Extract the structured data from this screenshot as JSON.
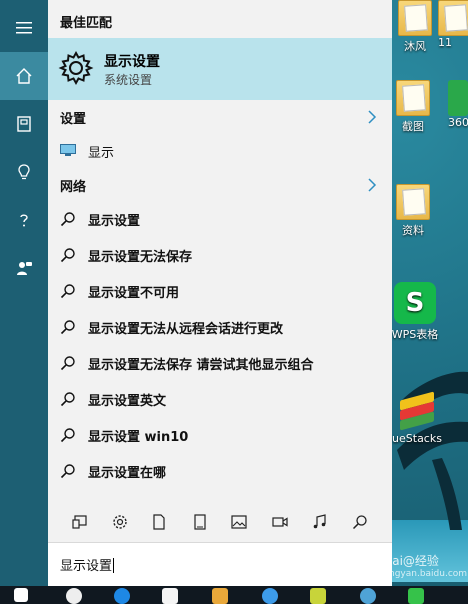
{
  "desktop": {
    "icons": [
      {
        "label": "沐风",
        "icon": "folder-icon"
      },
      {
        "label": "11",
        "icon": "folder-icon"
      },
      {
        "label": "截图",
        "icon": "folder-icon"
      },
      {
        "label": "360",
        "icon": "app-icon"
      },
      {
        "label": "资料",
        "icon": "folder-icon"
      },
      {
        "label": "WPS表格",
        "icon": "wps-spreadsheet-icon"
      },
      {
        "label": "ueStacks",
        "icon": "bluestacks-icon"
      }
    ]
  },
  "rail": {
    "items": [
      {
        "name": "menu",
        "icon": "hamburger-icon"
      },
      {
        "name": "home",
        "icon": "home-icon",
        "active": true
      },
      {
        "name": "notebook",
        "icon": "notebook-icon"
      },
      {
        "name": "tips",
        "icon": "lightbulb-icon"
      },
      {
        "name": "help",
        "icon": "question-icon"
      },
      {
        "name": "feedback",
        "icon": "feedback-icon"
      }
    ]
  },
  "panel": {
    "best_match_header": "最佳匹配",
    "best_match": {
      "title": "显示设置",
      "subtitle": "系统设置",
      "icon": "gear-icon"
    },
    "settings_header": "设置",
    "settings_item": {
      "label": "显示",
      "icon": "monitor-icon"
    },
    "web_header": "网络",
    "suggestions": [
      {
        "bold": "显示设置",
        "rest": ""
      },
      {
        "bold": "显示设置",
        "rest": "无法保存"
      },
      {
        "bold": "显示设置",
        "rest": "不可用"
      },
      {
        "bold": "显示设置",
        "rest": "无法从远程会话进行更改"
      },
      {
        "bold": "显示设置",
        "rest": "无法保存 请尝试其他显示组合"
      },
      {
        "bold": "显示设置",
        "rest": "英文"
      },
      {
        "bold": "显示设置",
        "rest": " win10"
      },
      {
        "bold": "显示设置",
        "rest": "在哪"
      }
    ],
    "filters": [
      {
        "name": "apps",
        "icon": "apps-icon"
      },
      {
        "name": "settings",
        "icon": "gear-icon"
      },
      {
        "name": "documents",
        "icon": "document-icon"
      },
      {
        "name": "folders",
        "icon": "folder-icon"
      },
      {
        "name": "photos",
        "icon": "photo-icon"
      },
      {
        "name": "videos",
        "icon": "video-icon"
      },
      {
        "name": "music",
        "icon": "music-icon"
      },
      {
        "name": "web",
        "icon": "search-icon"
      }
    ],
    "search_value": "显示设置"
  },
  "watermark": {
    "text": "Bai@经验",
    "site": "jingyan.baidu.com"
  },
  "colors": {
    "accent": "#b9e3ec",
    "rail": "#1d5f73",
    "rail_active": "#3b8aa0",
    "panel": "#f2f2f2"
  }
}
